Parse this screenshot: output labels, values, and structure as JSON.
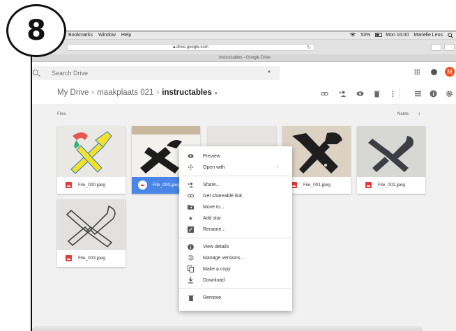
{
  "step_number": "8",
  "menubar": {
    "items": [
      "Bookmarks",
      "Window",
      "Help"
    ],
    "battery": "53%",
    "clock": "Mon 16:00",
    "user": "Marielle Lens"
  },
  "browser": {
    "url": "drive.google.com",
    "tab_title": "instructables - Google Drive"
  },
  "search": {
    "placeholder": "Search Drive"
  },
  "avatar_letter": "M",
  "breadcrumb": {
    "root": "My Drive",
    "folder": "maakplaats 021",
    "current": "instructables"
  },
  "files_section_label": "Files",
  "sort_label": "Name",
  "files": [
    {
      "name": "File_000.jpeg"
    },
    {
      "name": "File_000.jpeg"
    },
    {
      "name": "File_001.jpeg"
    },
    {
      "name": "File_002.jpeg"
    },
    {
      "name": "File_003.jpeg"
    }
  ],
  "context_menu": {
    "group1": [
      "Preview",
      "Open with"
    ],
    "group2": [
      "Share...",
      "Get shareable link",
      "Move to...",
      "Add star",
      "Rename..."
    ],
    "group3": [
      "View details",
      "Manage versions...",
      "Make a copy",
      "Download"
    ],
    "group4": [
      "Remove"
    ]
  },
  "colors": {
    "selected": "#4a86e8",
    "avatar": "#f4511e",
    "image_icon": "#e53935"
  }
}
